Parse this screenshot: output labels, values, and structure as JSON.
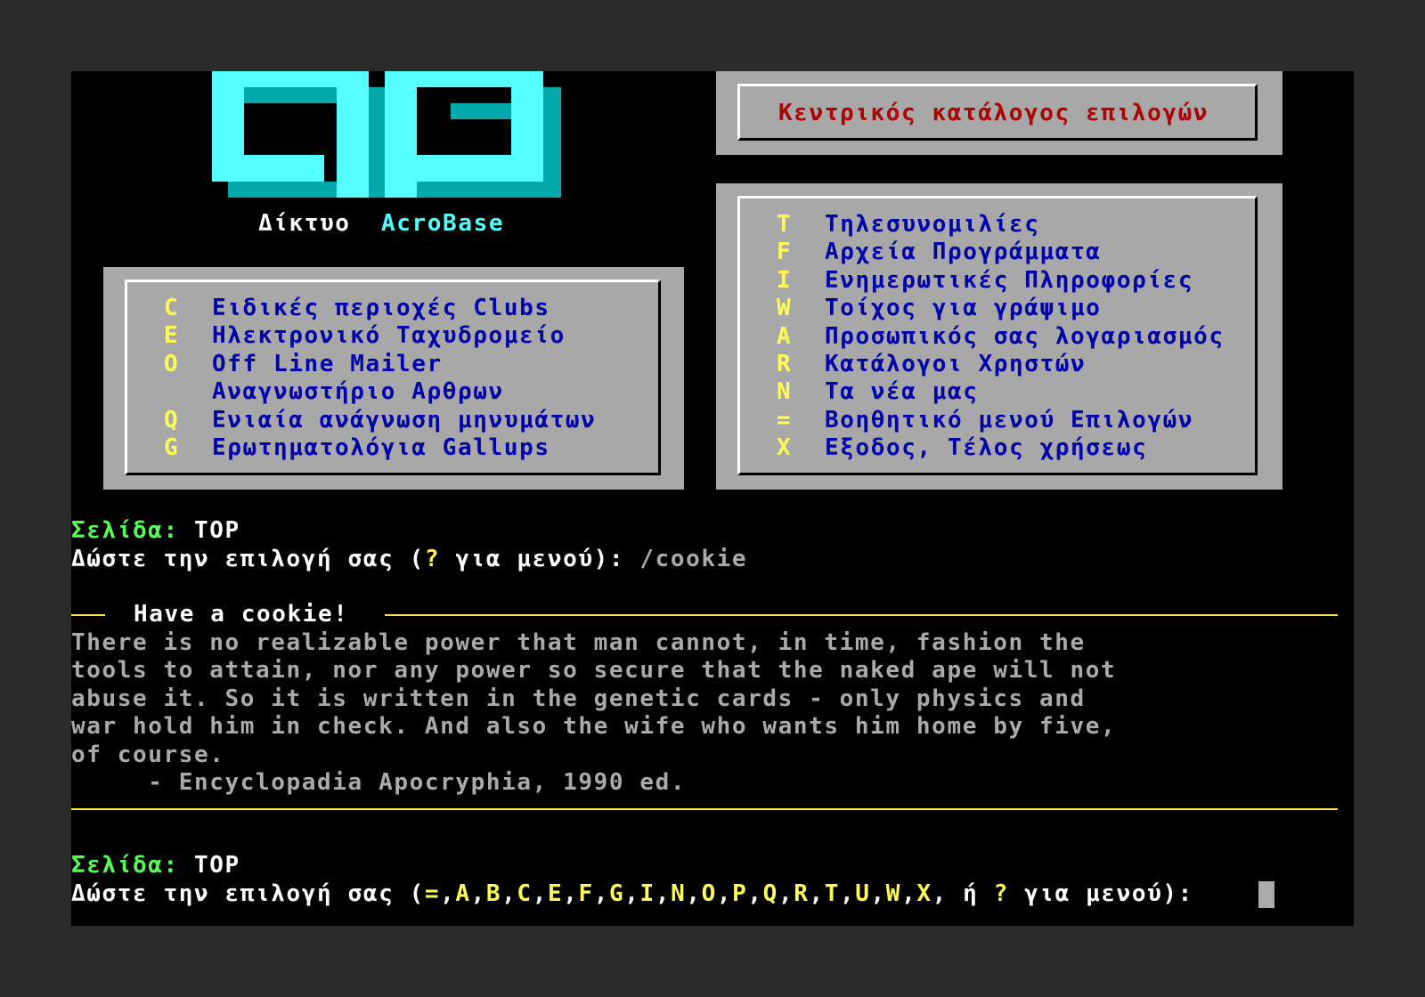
{
  "colors": {
    "background": "#000000",
    "panel": "#a8a8a8",
    "hotkey": "#ffff55",
    "menu_text": "#0000aa",
    "title_text": "#aa0000",
    "logo_cyan": "#55ffff",
    "prompt_label": "#55ff55",
    "rule": "#ffe14d"
  },
  "logo": {
    "icon": "acrobase-logo-icon",
    "network_word": "Δίκτυο",
    "brand": "AcroBase"
  },
  "main_title": "Κεντρικός κατάλογος επιλογών",
  "left_menu": [
    {
      "key": "C",
      "label": "Ειδικές περιοχές Clubs"
    },
    {
      "key": "E",
      "label": "Ηλεκτρονικό Ταχυδρομείο"
    },
    {
      "key": "O",
      "label": "Off Line Mailer"
    },
    {
      "key": "",
      "label": "Αναγνωστήριο Αρθρων"
    },
    {
      "key": "Q",
      "label": "Ενιαία ανάγνωση μηνυμάτων"
    },
    {
      "key": "G",
      "label": "Ερωτηματολόγια Gallups"
    }
  ],
  "right_menu": [
    {
      "key": "T",
      "label": "Τηλεσυνομιλίες"
    },
    {
      "key": "F",
      "label": "Αρχεία Προγράμματα"
    },
    {
      "key": "I",
      "label": "Ενημερωτικές Πληροφορίες"
    },
    {
      "key": "W",
      "label": "Τοίχος για γράψιμο"
    },
    {
      "key": "A",
      "label": "Προσωπικός σας λογαριασμός"
    },
    {
      "key": "R",
      "label": "Κατάλογοι Χρηστών"
    },
    {
      "key": "N",
      "label": "Τα νέα μας"
    },
    {
      "key": "=",
      "label": "Βοηθητικό μενού Επιλογών"
    },
    {
      "key": "X",
      "label": "Εξοδος, Τέλος χρήσεως"
    }
  ],
  "prompt1": {
    "page_label": "Σελίδα:",
    "page_value": "TOP",
    "ask_prefix": "Δώστε την επιλογή σας (",
    "ask_key": "?",
    "ask_suffix": " για μενού): ",
    "typed": "/cookie"
  },
  "cookie": {
    "title": "Have a cookie!",
    "lines": [
      "There is no realizable power that man cannot, in time, fashion the",
      "tools to attain, nor any power so secure that the naked ape will not",
      "abuse it. So it is written in the genetic cards - only physics and",
      "war hold him in check. And also the wife who wants him home by five,",
      "of course.",
      "     - Encyclopadia Apocryphia, 1990 ed."
    ]
  },
  "prompt2": {
    "page_label": "Σελίδα:",
    "page_value": "TOP",
    "ask_prefix": "Δώστε την επιλογή σας (",
    "keys": [
      "=",
      "A",
      "B",
      "C",
      "E",
      "F",
      "G",
      "I",
      "N",
      "O",
      "P",
      "Q",
      "R",
      "T",
      "U",
      "W",
      "X"
    ],
    "separator": ",",
    "or_word": ", ή ",
    "help_key": "?",
    "ask_suffix": " για μενού): "
  }
}
